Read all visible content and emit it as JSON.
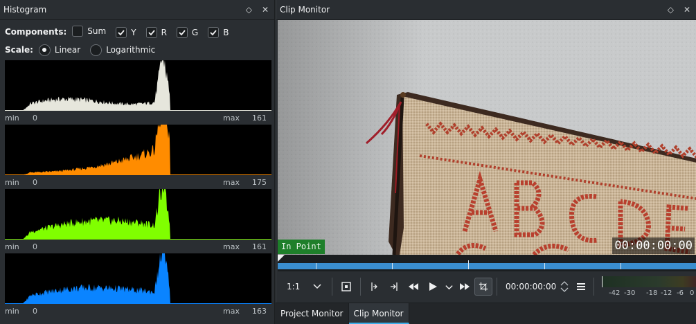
{
  "histogram": {
    "title": "Histogram",
    "components_label": "Components:",
    "components": [
      {
        "label": "Sum",
        "checked": false
      },
      {
        "label": "Y",
        "checked": true
      },
      {
        "label": "R",
        "checked": true
      },
      {
        "label": "G",
        "checked": true
      },
      {
        "label": "B",
        "checked": true
      }
    ],
    "scale_label": "Scale:",
    "scales": [
      {
        "label": "Linear",
        "selected": true
      },
      {
        "label": "Logarithmic",
        "selected": false
      }
    ],
    "channels": [
      {
        "name": "Y",
        "color": "#e6e6dc",
        "min_label": "min",
        "min_value": "0",
        "max_label": "max",
        "max_value": "161"
      },
      {
        "name": "R",
        "color": "#ff8c00",
        "min_label": "min",
        "min_value": "0",
        "max_label": "max",
        "max_value": "175"
      },
      {
        "name": "G",
        "color": "#80ff00",
        "min_label": "min",
        "min_value": "0",
        "max_label": "max",
        "max_value": "161"
      },
      {
        "name": "B",
        "color": "#0a84ff",
        "min_label": "min",
        "min_value": "0",
        "max_label": "max",
        "max_value": "163"
      }
    ],
    "float_icon": "diamond-icon",
    "close_icon": "close-icon"
  },
  "clip_monitor": {
    "title": "Clip Monitor",
    "in_point_label": "In Point",
    "overlay_timecode": "00:00:00:00",
    "zoom_value": "1:1",
    "timecode": "00:00:00:00",
    "audio_scale": [
      "-42",
      "-30",
      "-18",
      "-12",
      "-6",
      "0"
    ],
    "accent": "#3a8ecf"
  },
  "tabs": [
    {
      "label": "Project Monitor",
      "active": false
    },
    {
      "label": "Clip Monitor",
      "active": true
    }
  ]
}
